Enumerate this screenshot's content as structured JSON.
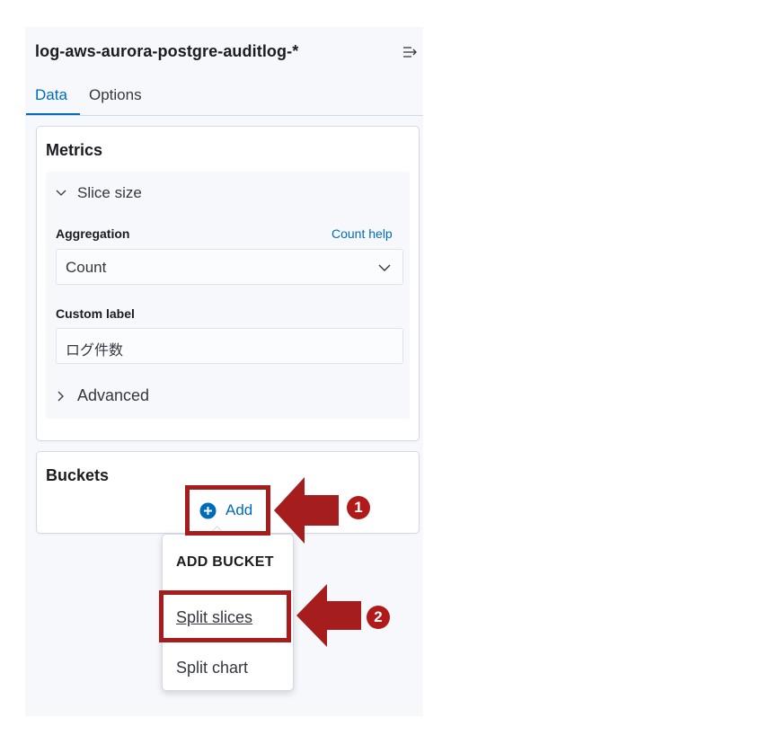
{
  "header": {
    "index_pattern": "log-aws-aurora-postgre-auditlog-*"
  },
  "tabs": [
    {
      "label": "Data",
      "active": true
    },
    {
      "label": "Options",
      "active": false
    }
  ],
  "metrics": {
    "title": "Metrics",
    "slice_size_label": "Slice size",
    "aggregation_label": "Aggregation",
    "help_link": "Count help",
    "aggregation_value": "Count",
    "custom_label_title": "Custom label",
    "custom_label_value": "ログ件数",
    "advanced_label": "Advanced"
  },
  "buckets": {
    "title": "Buckets",
    "add_label": "Add"
  },
  "popover": {
    "title": "ADD BUCKET",
    "items": [
      "Split slices",
      "Split chart"
    ]
  },
  "annotations": {
    "step1": "1",
    "step2": "2",
    "highlight_color": "#a51d1d"
  },
  "colors": {
    "link": "#006bb8",
    "panel_bg": "#f7f8fc",
    "border": "#d3dae6"
  },
  "icons": [
    "collapse-panel-icon",
    "chevron-down-icon",
    "chevron-right-icon",
    "plus-circle-icon",
    "arrow-left-icon"
  ]
}
